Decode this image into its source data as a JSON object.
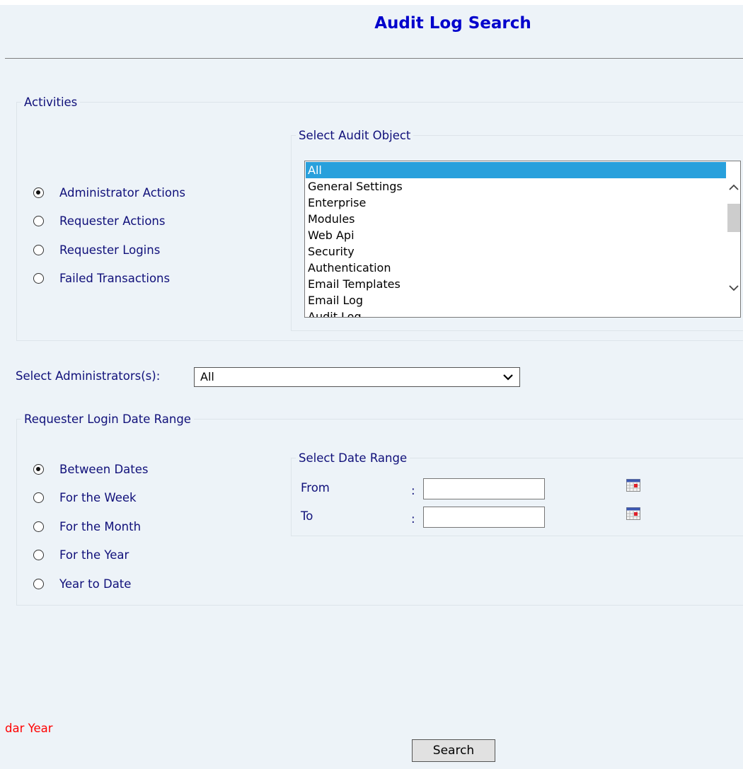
{
  "page": {
    "title": "Audit Log Search"
  },
  "activities": {
    "legend": "Activities",
    "options": [
      {
        "label": "Administrator Actions",
        "checked": true
      },
      {
        "label": "Requester Actions",
        "checked": false
      },
      {
        "label": "Requester Logins",
        "checked": false
      },
      {
        "label": "Failed Transactions",
        "checked": false
      }
    ],
    "audit_object": {
      "legend": "Select Audit Object",
      "items": [
        "All",
        "General Settings",
        "Enterprise",
        "Modules",
        "Web Api",
        "Security",
        "Authentication",
        "Email Templates",
        "Email Log",
        "Audit Log"
      ],
      "selected": "All"
    }
  },
  "administrators": {
    "label": "Select Administrators(s):",
    "value": "All"
  },
  "login_date_range": {
    "legend": "Requester Login Date Range",
    "options": [
      {
        "label": "Between Dates",
        "checked": true
      },
      {
        "label": "For the Week",
        "checked": false
      },
      {
        "label": "For the Month",
        "checked": false
      },
      {
        "label": "For the Year",
        "checked": false
      },
      {
        "label": "Year to Date",
        "checked": false
      }
    ],
    "date_range": {
      "legend": "Select Date Range",
      "from_label": "From",
      "to_label": "To",
      "separator": ":",
      "from_value": "",
      "to_value": ""
    }
  },
  "footnote": "dar Year",
  "search_button": "Search",
  "colors": {
    "accent_blue": "#0000cc",
    "label_navy": "#10107a",
    "selection": "#28a0dc",
    "warning_red": "#ff0000"
  }
}
